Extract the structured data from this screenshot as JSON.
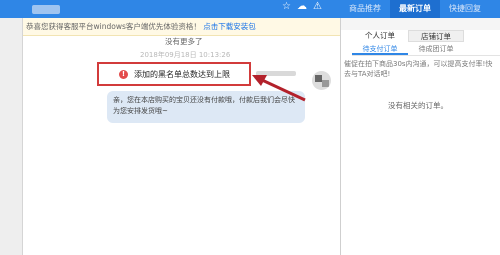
{
  "toolbar": {
    "icons": [
      "star-icon",
      "cloud-icon",
      "warning-icon"
    ]
  },
  "right_tabs": {
    "items": [
      {
        "label": "商品推荐"
      },
      {
        "label": "最新订单"
      },
      {
        "label": "快捷回复"
      }
    ],
    "active_index": 1
  },
  "notice": {
    "text": "恭喜您获得客服平台windows客户端优先体验资格！",
    "link": "点击下载安装包"
  },
  "chat": {
    "no_more": "没有更多了",
    "timestamp": "2018年09月18日 10:13:26",
    "alert_text": "添加的黑名单总数达到上限",
    "bubble_text": "亲，您在本店购买的宝贝还没有付款哦，付款后我们会尽快为您安排发货哦~"
  },
  "orders": {
    "segments": [
      "个人订单",
      "店铺订单"
    ],
    "active_segment": 1,
    "subtabs": [
      "待支付订单",
      "待成团订单"
    ],
    "active_subtab": 0,
    "hint": "催促在拍下商品30s内沟通，可以提高支付率!快去与TA对话吧!",
    "empty": "没有相关的订单。"
  },
  "colors": {
    "brand_blue": "#2f86e6",
    "alert_red": "#d23b3b",
    "bubble_bg": "#dde8f5"
  }
}
